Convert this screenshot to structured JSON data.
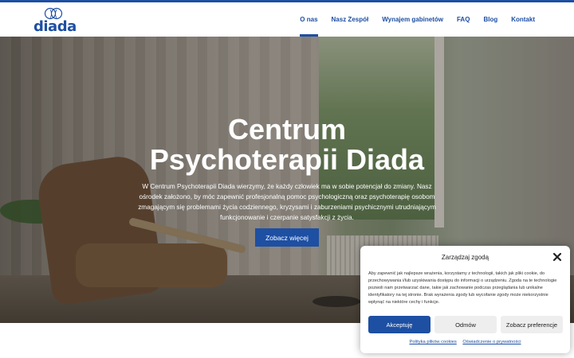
{
  "logo": {
    "text": "diada"
  },
  "nav": {
    "items": [
      {
        "label": "O nas",
        "active": true
      },
      {
        "label": "Nasz Zespół",
        "active": false
      },
      {
        "label": "Wynajem gabinetów",
        "active": false
      },
      {
        "label": "FAQ",
        "active": false
      },
      {
        "label": "Blog",
        "active": false
      },
      {
        "label": "Kontakt",
        "active": false
      }
    ]
  },
  "hero": {
    "title_line1": "Centrum",
    "title_line2": "Psychoterapii Diada",
    "text": "W Centrum Psychoterapii Diada wierzymy, że każdy człowiek ma w sobie potencjał do zmiany. Nasz ośrodek założono, by móc zapewnić profesjonalną pomoc psychologiczną oraz psychoterapię osobom zmagającym się problemami życia codziennego, kryzysami i zaburzeniami psychicznymi utrudniającym funkcjonowanie i czerpanie satysfakcji z życia.",
    "button": "Zobacz więcej"
  },
  "cookie": {
    "title": "Zarządzaj zgodą",
    "text": "Aby zapewnić jak najlepsze wrażenia, korzystamy z technologii, takich jak pliki cookie, do przechowywania i/lub uzyskiwania dostępu do informacji o urządzeniu. Zgoda na te technologie pozwoli nam przetwarzać dane, takie jak zachowanie podczas przeglądania lub unikalne identyfikatory na tej stronie. Brak wyrażenia zgody lub wycofanie zgody może niekorzystnie wpłynąć na niektóre cechy i funkcje.",
    "accept": "Akceptuję",
    "deny": "Odmów",
    "preferences": "Zobacz preferencje",
    "link_cookies": "Polityka plików cookies",
    "link_privacy": "Oświadczenie o prywatności"
  },
  "colors": {
    "brand": "#1d4fa3",
    "white": "#ffffff"
  }
}
